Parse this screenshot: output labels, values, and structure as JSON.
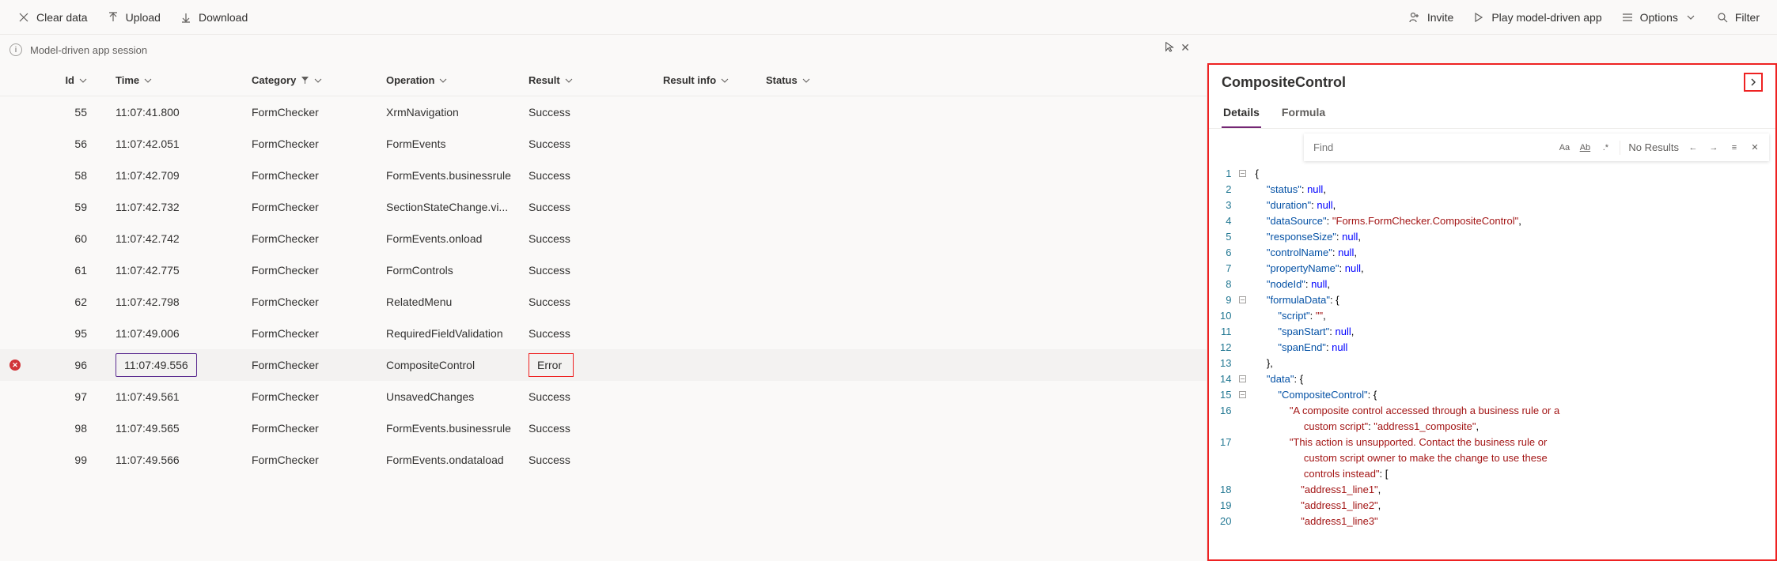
{
  "toolbar": {
    "clear_data": "Clear data",
    "upload": "Upload",
    "download": "Download",
    "invite": "Invite",
    "play": "Play model-driven app",
    "options": "Options",
    "filter": "Filter"
  },
  "session": {
    "label": "Model-driven app session"
  },
  "columns": {
    "id": "Id",
    "time": "Time",
    "category": "Category",
    "operation": "Operation",
    "result": "Result",
    "result_info": "Result info",
    "status": "Status"
  },
  "rows": [
    {
      "id": "55",
      "time": "11:07:41.800",
      "category": "FormChecker",
      "operation": "XrmNavigation",
      "result": "Success",
      "error": false
    },
    {
      "id": "56",
      "time": "11:07:42.051",
      "category": "FormChecker",
      "operation": "FormEvents",
      "result": "Success",
      "error": false
    },
    {
      "id": "58",
      "time": "11:07:42.709",
      "category": "FormChecker",
      "operation": "FormEvents.businessrule",
      "result": "Success",
      "error": false
    },
    {
      "id": "59",
      "time": "11:07:42.732",
      "category": "FormChecker",
      "operation": "SectionStateChange.vi...",
      "result": "Success",
      "error": false
    },
    {
      "id": "60",
      "time": "11:07:42.742",
      "category": "FormChecker",
      "operation": "FormEvents.onload",
      "result": "Success",
      "error": false
    },
    {
      "id": "61",
      "time": "11:07:42.775",
      "category": "FormChecker",
      "operation": "FormControls",
      "result": "Success",
      "error": false
    },
    {
      "id": "62",
      "time": "11:07:42.798",
      "category": "FormChecker",
      "operation": "RelatedMenu",
      "result": "Success",
      "error": false
    },
    {
      "id": "95",
      "time": "11:07:49.006",
      "category": "FormChecker",
      "operation": "RequiredFieldValidation",
      "result": "Success",
      "error": false
    },
    {
      "id": "96",
      "time": "11:07:49.556",
      "category": "FormChecker",
      "operation": "CompositeControl",
      "result": "Error",
      "error": true,
      "selected": true
    },
    {
      "id": "97",
      "time": "11:07:49.561",
      "category": "FormChecker",
      "operation": "UnsavedChanges",
      "result": "Success",
      "error": false
    },
    {
      "id": "98",
      "time": "11:07:49.565",
      "category": "FormChecker",
      "operation": "FormEvents.businessrule",
      "result": "Success",
      "error": false
    },
    {
      "id": "99",
      "time": "11:07:49.566",
      "category": "FormChecker",
      "operation": "FormEvents.ondataload",
      "result": "Success",
      "error": false
    }
  ],
  "side": {
    "title": "CompositeControl",
    "tabs": {
      "details": "Details",
      "formula": "Formula"
    },
    "find": {
      "placeholder": "Find",
      "no_results": "No Results"
    }
  },
  "code": {
    "lines": [
      {
        "n": 1,
        "fold": "-",
        "html": "<span class='tk-pun'>{</span>"
      },
      {
        "n": 2,
        "fold": "",
        "html": "    <span class='tk-prop'>\"status\"</span>: <span class='tk-null'>null</span>,"
      },
      {
        "n": 3,
        "fold": "",
        "html": "    <span class='tk-prop'>\"duration\"</span>: <span class='tk-null'>null</span>,"
      },
      {
        "n": 4,
        "fold": "",
        "html": "    <span class='tk-prop'>\"dataSource\"</span>: <span class='tk-str'>\"Forms.FormChecker.CompositeControl\"</span>,"
      },
      {
        "n": 5,
        "fold": "",
        "html": "    <span class='tk-prop'>\"responseSize\"</span>: <span class='tk-null'>null</span>,"
      },
      {
        "n": 6,
        "fold": "",
        "html": "    <span class='tk-prop'>\"controlName\"</span>: <span class='tk-null'>null</span>,"
      },
      {
        "n": 7,
        "fold": "",
        "html": "    <span class='tk-prop'>\"propertyName\"</span>: <span class='tk-null'>null</span>,"
      },
      {
        "n": 8,
        "fold": "",
        "html": "    <span class='tk-prop'>\"nodeId\"</span>: <span class='tk-null'>null</span>,"
      },
      {
        "n": 9,
        "fold": "-",
        "html": "    <span class='tk-prop'>\"formulaData\"</span>: <span class='tk-pun'>{</span>"
      },
      {
        "n": 10,
        "fold": "",
        "html": "        <span class='tk-prop'>\"script\"</span>: <span class='tk-str'>\"\"</span>,"
      },
      {
        "n": 11,
        "fold": "",
        "html": "        <span class='tk-prop'>\"spanStart\"</span>: <span class='tk-null'>null</span>,"
      },
      {
        "n": 12,
        "fold": "",
        "html": "        <span class='tk-prop'>\"spanEnd\"</span>: <span class='tk-null'>null</span>"
      },
      {
        "n": 13,
        "fold": "",
        "html": "    <span class='tk-pun'>},</span>"
      },
      {
        "n": 14,
        "fold": "-",
        "html": "    <span class='tk-prop'>\"data\"</span>: <span class='tk-pun'>{</span>"
      },
      {
        "n": 15,
        "fold": "-",
        "html": "        <span class='tk-prop'>\"CompositeControl\"</span>: <span class='tk-pun'>{</span>"
      },
      {
        "n": 16,
        "fold": "",
        "html": "            <span class='tk-str'>\"A composite control accessed through a business rule or a</span><br>                 <span class='tk-str'>custom script\"</span>: <span class='tk-str'>\"address1_composite\"</span>,"
      },
      {
        "n": 17,
        "fold": "",
        "html": "            <span class='tk-str'>\"This action is unsupported. Contact the business rule or</span><br>                 <span class='tk-str'>custom script owner to make the change to use these</span><br>                 <span class='tk-str'>controls instead\"</span>: <span class='tk-pun'>[</span>"
      },
      {
        "n": 18,
        "fold": "",
        "html": "                <span class='tk-str'>\"address1_line1\"</span>,"
      },
      {
        "n": 19,
        "fold": "",
        "html": "                <span class='tk-str'>\"address1_line2\"</span>,"
      },
      {
        "n": 20,
        "fold": "",
        "html": "                <span class='tk-str'>\"address1_line3\"</span>"
      }
    ]
  }
}
